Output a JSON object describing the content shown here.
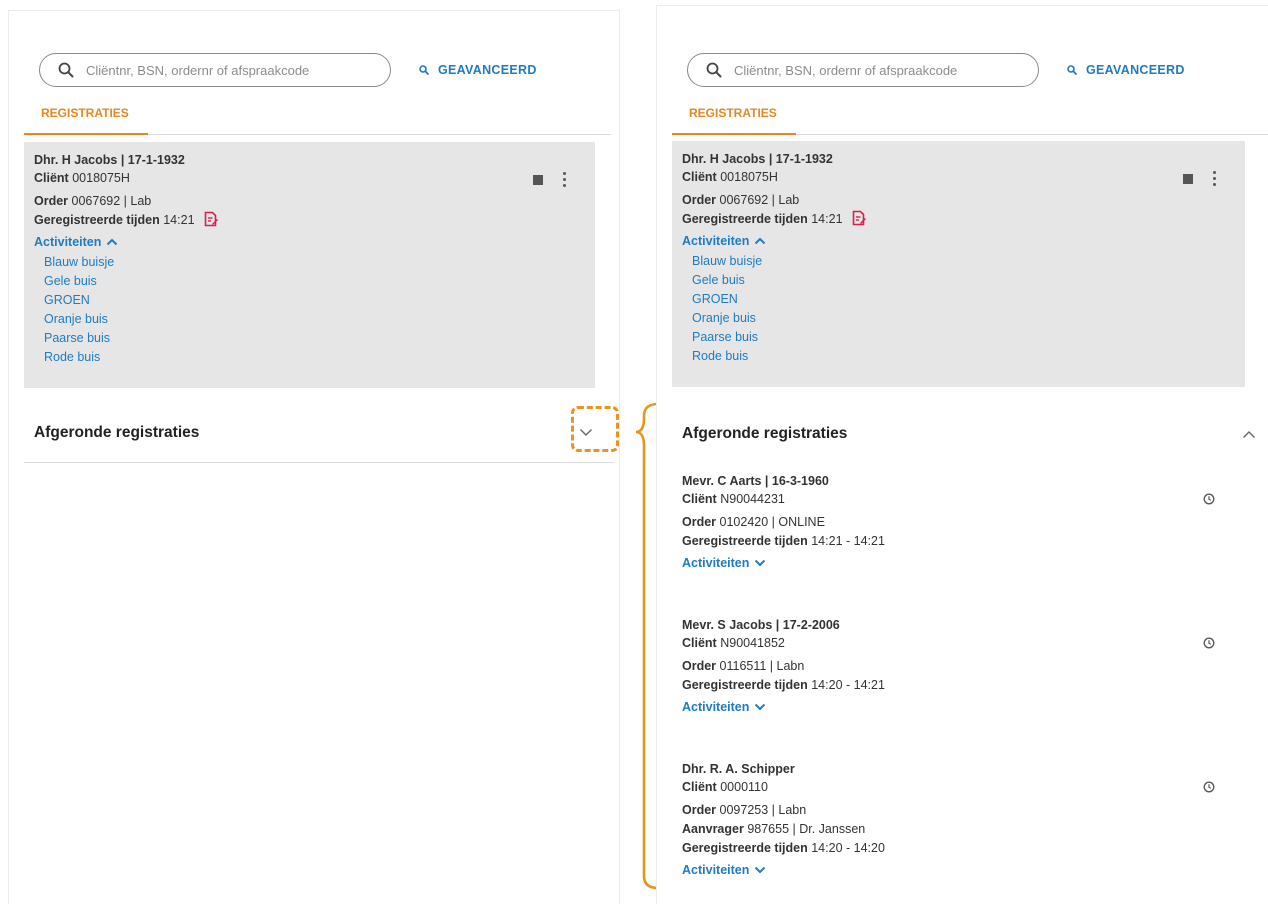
{
  "search": {
    "placeholder": "Cliëntnr, BSN, ordernr of afspraakcode",
    "value": ""
  },
  "advanced_label": "GEAVANCEERD",
  "tab_label": "REGISTRATIES",
  "active_registration": {
    "name": "Dhr. H Jacobs | 17-1-1932",
    "client_label": "Cliënt",
    "client_value": "0018075H",
    "order_label": "Order",
    "order_value": "0067692 | Lab",
    "times_label": "Geregistreerde tijden",
    "times_value": "14:21",
    "activities_label": "Activiteiten",
    "activities": [
      "Blauw buisje",
      "Gele buis",
      "GROEN",
      "Oranje buis",
      "Paarse buis",
      "Rode buis"
    ]
  },
  "completed_section_title": "Afgeronde registraties",
  "completed": [
    {
      "name": "Mevr. C Aarts | 16-3-1960",
      "client_label": "Cliënt",
      "client_value": "N90044231",
      "order_label": "Order",
      "order_value": "0102420 | ONLINE",
      "times_label": "Geregistreerde tijden",
      "times_value": "14:21 - 14:21",
      "activities_label": "Activiteiten"
    },
    {
      "name": "Mevr. S Jacobs | 17-2-2006",
      "client_label": "Cliënt",
      "client_value": "N90041852",
      "order_label": "Order",
      "order_value": "0116511 | Labn",
      "times_label": "Geregistreerde tijden",
      "times_value": "14:20 - 14:21",
      "activities_label": "Activiteiten"
    },
    {
      "name": "Dhr. R. A. Schipper",
      "client_label": "Cliënt",
      "client_value": "0000110",
      "order_label": "Order",
      "order_value": "0097253 | Labn",
      "requester_label": "Aanvrager",
      "requester_value": "987655 | Dr. Janssen",
      "times_label": "Geregistreerde tijden",
      "times_value": "14:20 - 14:20",
      "activities_label": "Activiteiten"
    }
  ],
  "colors": {
    "accent_orange": "#e8871e",
    "link_blue": "#1e7bc4",
    "card_grey": "#e6e6e6",
    "register_icon_red": "#d6204e"
  },
  "icons": [
    "search-icon",
    "stop-icon",
    "kebab-menu-icon",
    "register-edit-icon",
    "chevron-up-icon",
    "chevron-down-icon",
    "clock-icon",
    "curly-brace"
  ]
}
